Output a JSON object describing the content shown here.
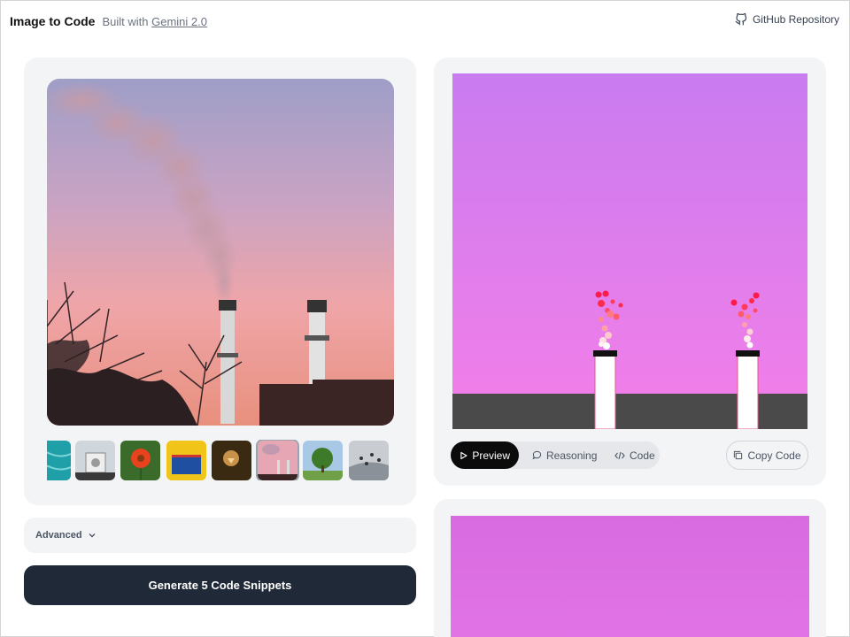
{
  "header": {
    "brand": "Image to Code",
    "built_prefix": "Built with",
    "built_link": "Gemini 2.0",
    "github": "GitHub Repository"
  },
  "left": {
    "advanced_label": "Advanced",
    "generate_label": "Generate 5 Code Snippets"
  },
  "right": {
    "tabs": [
      {
        "label": "Preview",
        "icon": "play-icon",
        "active": true
      },
      {
        "label": "Reasoning",
        "icon": "chat-bubble-icon",
        "active": false
      },
      {
        "label": "Code",
        "icon": "code-icon",
        "active": false
      }
    ],
    "copy_label": "Copy Code"
  },
  "colors": {
    "accent_dark": "#1f2937",
    "card_bg": "#f3f4f6",
    "preview_sky_top": "#c97bf0",
    "preview_sky_bottom": "#f47fe8",
    "ground": "#4a4a4a"
  }
}
